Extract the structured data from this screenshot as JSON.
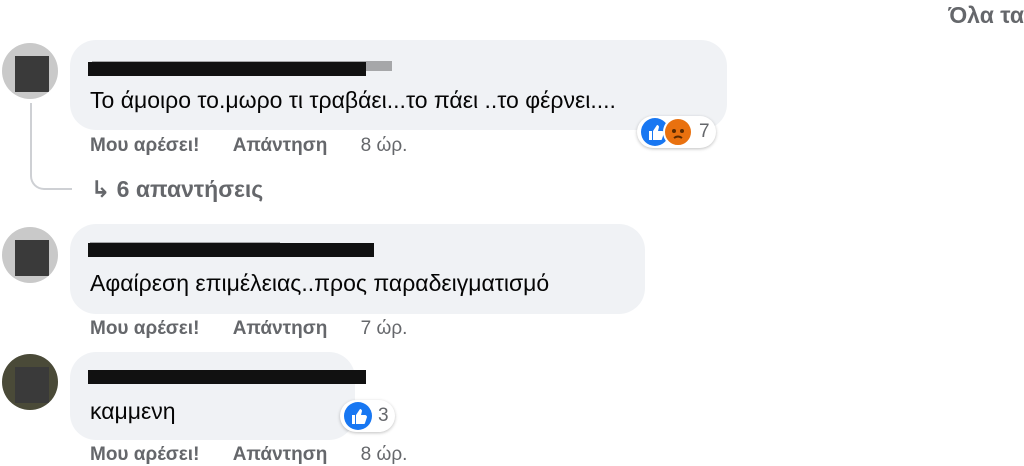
{
  "filter_label": "Όλα τα",
  "comments": [
    {
      "text": "Το άμοιρο το.μωρο τι τραβάει...το πάει ..το φέρνει....",
      "like_label": "Μου αρέσει!",
      "reply_label": "Απάντηση",
      "time": "8 ώρ.",
      "reaction_count": "7",
      "replies_label": "6 απαντήσεις"
    },
    {
      "text": "Αφαίρεση επιμέλειας..προς παραδειγματισμό",
      "like_label": "Μου αρέσει!",
      "reply_label": "Απάντηση",
      "time": "7 ώρ."
    },
    {
      "text": "καμμενη",
      "like_label": "Μου αρέσει!",
      "reply_label": "Απάντηση",
      "time": "8 ώρ.",
      "reaction_count": "3"
    }
  ],
  "icons": [
    "like-reaction-icon",
    "angry-reaction-icon",
    "reply-arrow-icon"
  ],
  "colors": {
    "bubble": "#f0f2f5",
    "like": "#1877f2",
    "angry": "#e9710f",
    "meta": "#65676b"
  }
}
